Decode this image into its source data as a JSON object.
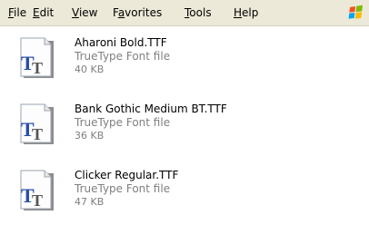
{
  "menu": [
    {
      "mnemonic": "F",
      "rest": "ile"
    },
    {
      "mnemonic": "E",
      "rest": "dit"
    },
    {
      "mnemonic": "V",
      "rest": "iew"
    },
    {
      "mnemonic": "a",
      "pre": "F",
      "rest": "vorites"
    },
    {
      "mnemonic": "T",
      "rest": "ools"
    },
    {
      "mnemonic": "H",
      "rest": "elp"
    }
  ],
  "files": [
    {
      "name": "Aharoni Bold.TTF",
      "type": "TrueType Font file",
      "size": "40 KB",
      "icon": "truetype-font-icon"
    },
    {
      "name": "Bank Gothic Medium BT.TTF",
      "type": "TrueType Font file",
      "size": "36 KB",
      "icon": "truetype-font-icon"
    },
    {
      "name": "Clicker Regular.TTF",
      "type": "TrueType Font file",
      "size": "47 KB",
      "icon": "truetype-font-icon"
    }
  ],
  "colors": {
    "menubar_bg": "#ece9d8",
    "secondary_text": "#808080",
    "icon_letter_blue": "#2a4fa8"
  }
}
